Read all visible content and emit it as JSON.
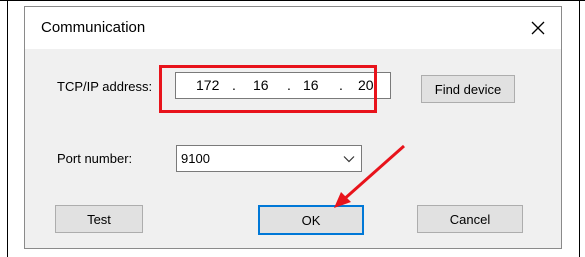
{
  "dialog": {
    "title": "Communication",
    "close_glyph": "✕"
  },
  "tcpip": {
    "label": "TCP/IP address:",
    "octets": [
      "172",
      "16",
      "16",
      "20"
    ],
    "separator": "."
  },
  "find_device_label": "Find device",
  "port": {
    "label": "Port number:",
    "value": "9100"
  },
  "buttons": {
    "test": "Test",
    "ok": "OK",
    "cancel": "Cancel"
  },
  "annotations": {
    "highlight_color": "#e8131b",
    "arrow_color": "#e8131b"
  },
  "icons": {
    "close": "close-icon",
    "dropdown": "chevron-down-icon",
    "arrow": "red-arrow-annotation"
  }
}
